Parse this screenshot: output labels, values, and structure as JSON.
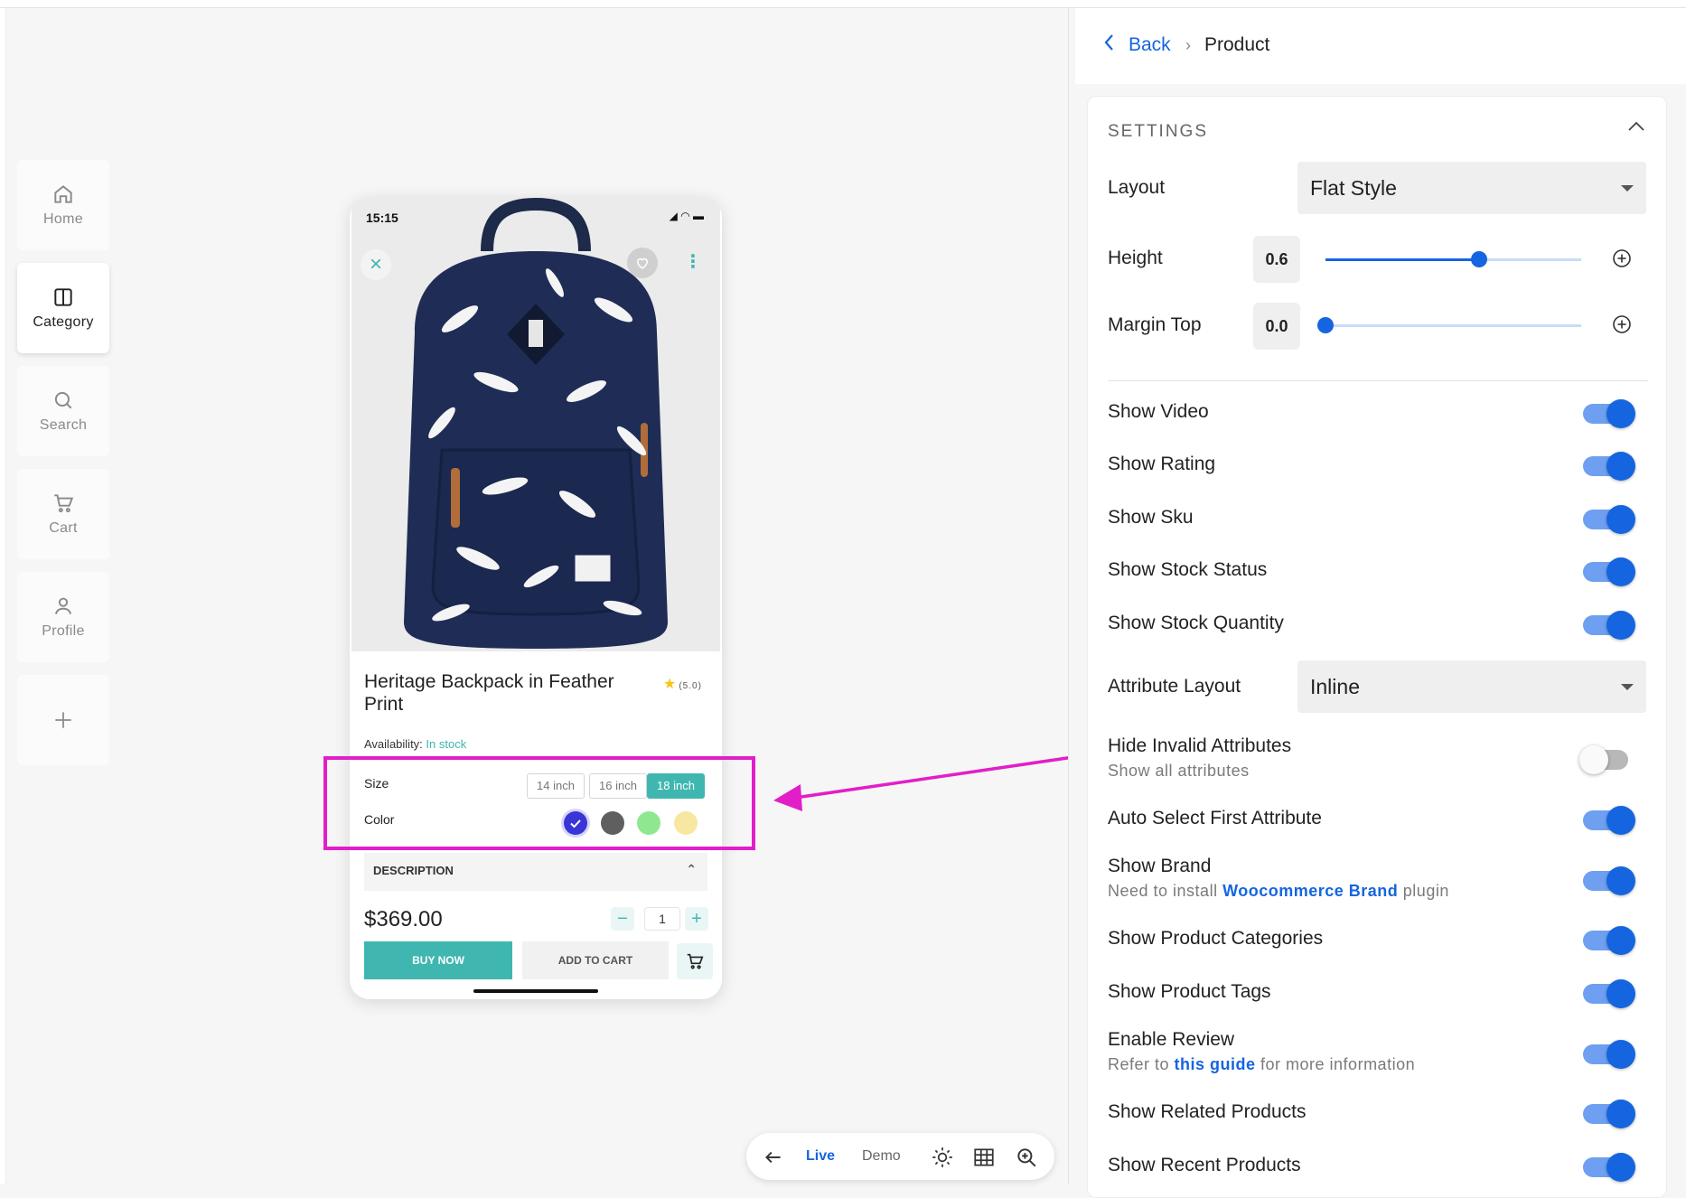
{
  "nav": {
    "items": [
      {
        "label": "Home",
        "icon": "home-icon"
      },
      {
        "label": "Category",
        "icon": "category-icon"
      },
      {
        "label": "Search",
        "icon": "search-icon"
      },
      {
        "label": "Cart",
        "icon": "cart-icon"
      },
      {
        "label": "Profile",
        "icon": "profile-icon"
      }
    ],
    "active": "Category"
  },
  "phone": {
    "status_time": "15:15",
    "product_title": "Heritage Backpack in Feather Print",
    "rating": "(5.0)",
    "availability_label": "Availability:",
    "availability_value": "In stock",
    "size_label": "Size",
    "sizes": [
      "14 inch",
      "16 inch",
      "18 inch"
    ],
    "selected_size": "18 inch",
    "color_label": "Color",
    "colors": [
      "#3a35d6",
      "#5f5f5f",
      "#8fe88f",
      "#f7e7a0"
    ],
    "description_label": "DESCRIPTION",
    "price": "$369.00",
    "quantity": "1",
    "buy_now": "BUY NOW",
    "add_to_cart": "ADD TO CART",
    "accent_color": "#3fb7b0"
  },
  "toolbar": {
    "live": "Live",
    "demo": "Demo"
  },
  "panel": {
    "back": "Back",
    "breadcrumb_current": "Product",
    "section_title": "SETTINGS",
    "layout_label": "Layout",
    "layout_value": "Flat Style",
    "height_label": "Height",
    "height_value": "0.6",
    "height_fraction": 0.6,
    "margin_top_label": "Margin Top",
    "margin_top_value": "0.0",
    "margin_top_fraction": 0.0,
    "attribute_layout_label": "Attribute Layout",
    "attribute_layout_value": "Inline",
    "toggles": [
      {
        "label": "Show Video",
        "on": true
      },
      {
        "label": "Show Rating",
        "on": true
      },
      {
        "label": "Show Sku",
        "on": true
      },
      {
        "label": "Show Stock Status",
        "on": true
      },
      {
        "label": "Show Stock Quantity",
        "on": true
      },
      {
        "label": "Hide Invalid Attributes",
        "sub": "Show all attributes",
        "on": false
      },
      {
        "label": "Auto Select First Attribute",
        "on": true
      },
      {
        "label": "Show Brand",
        "on": true
      },
      {
        "label": "Show Product Categories",
        "on": true
      },
      {
        "label": "Show Product Tags",
        "on": true
      },
      {
        "label": "Enable Review",
        "on": true
      },
      {
        "label": "Show Related Products",
        "on": true
      },
      {
        "label": "Show Recent Products",
        "on": true
      }
    ],
    "brand_sub": {
      "before": "Need to install ",
      "link": "Woocommerce Brand",
      "after": " plugin"
    },
    "review_sub": {
      "before": "Refer to ",
      "link": "this guide",
      "after": " for more information"
    },
    "accent_color": "#1565e0",
    "highlight_color": "#e21ec8"
  }
}
